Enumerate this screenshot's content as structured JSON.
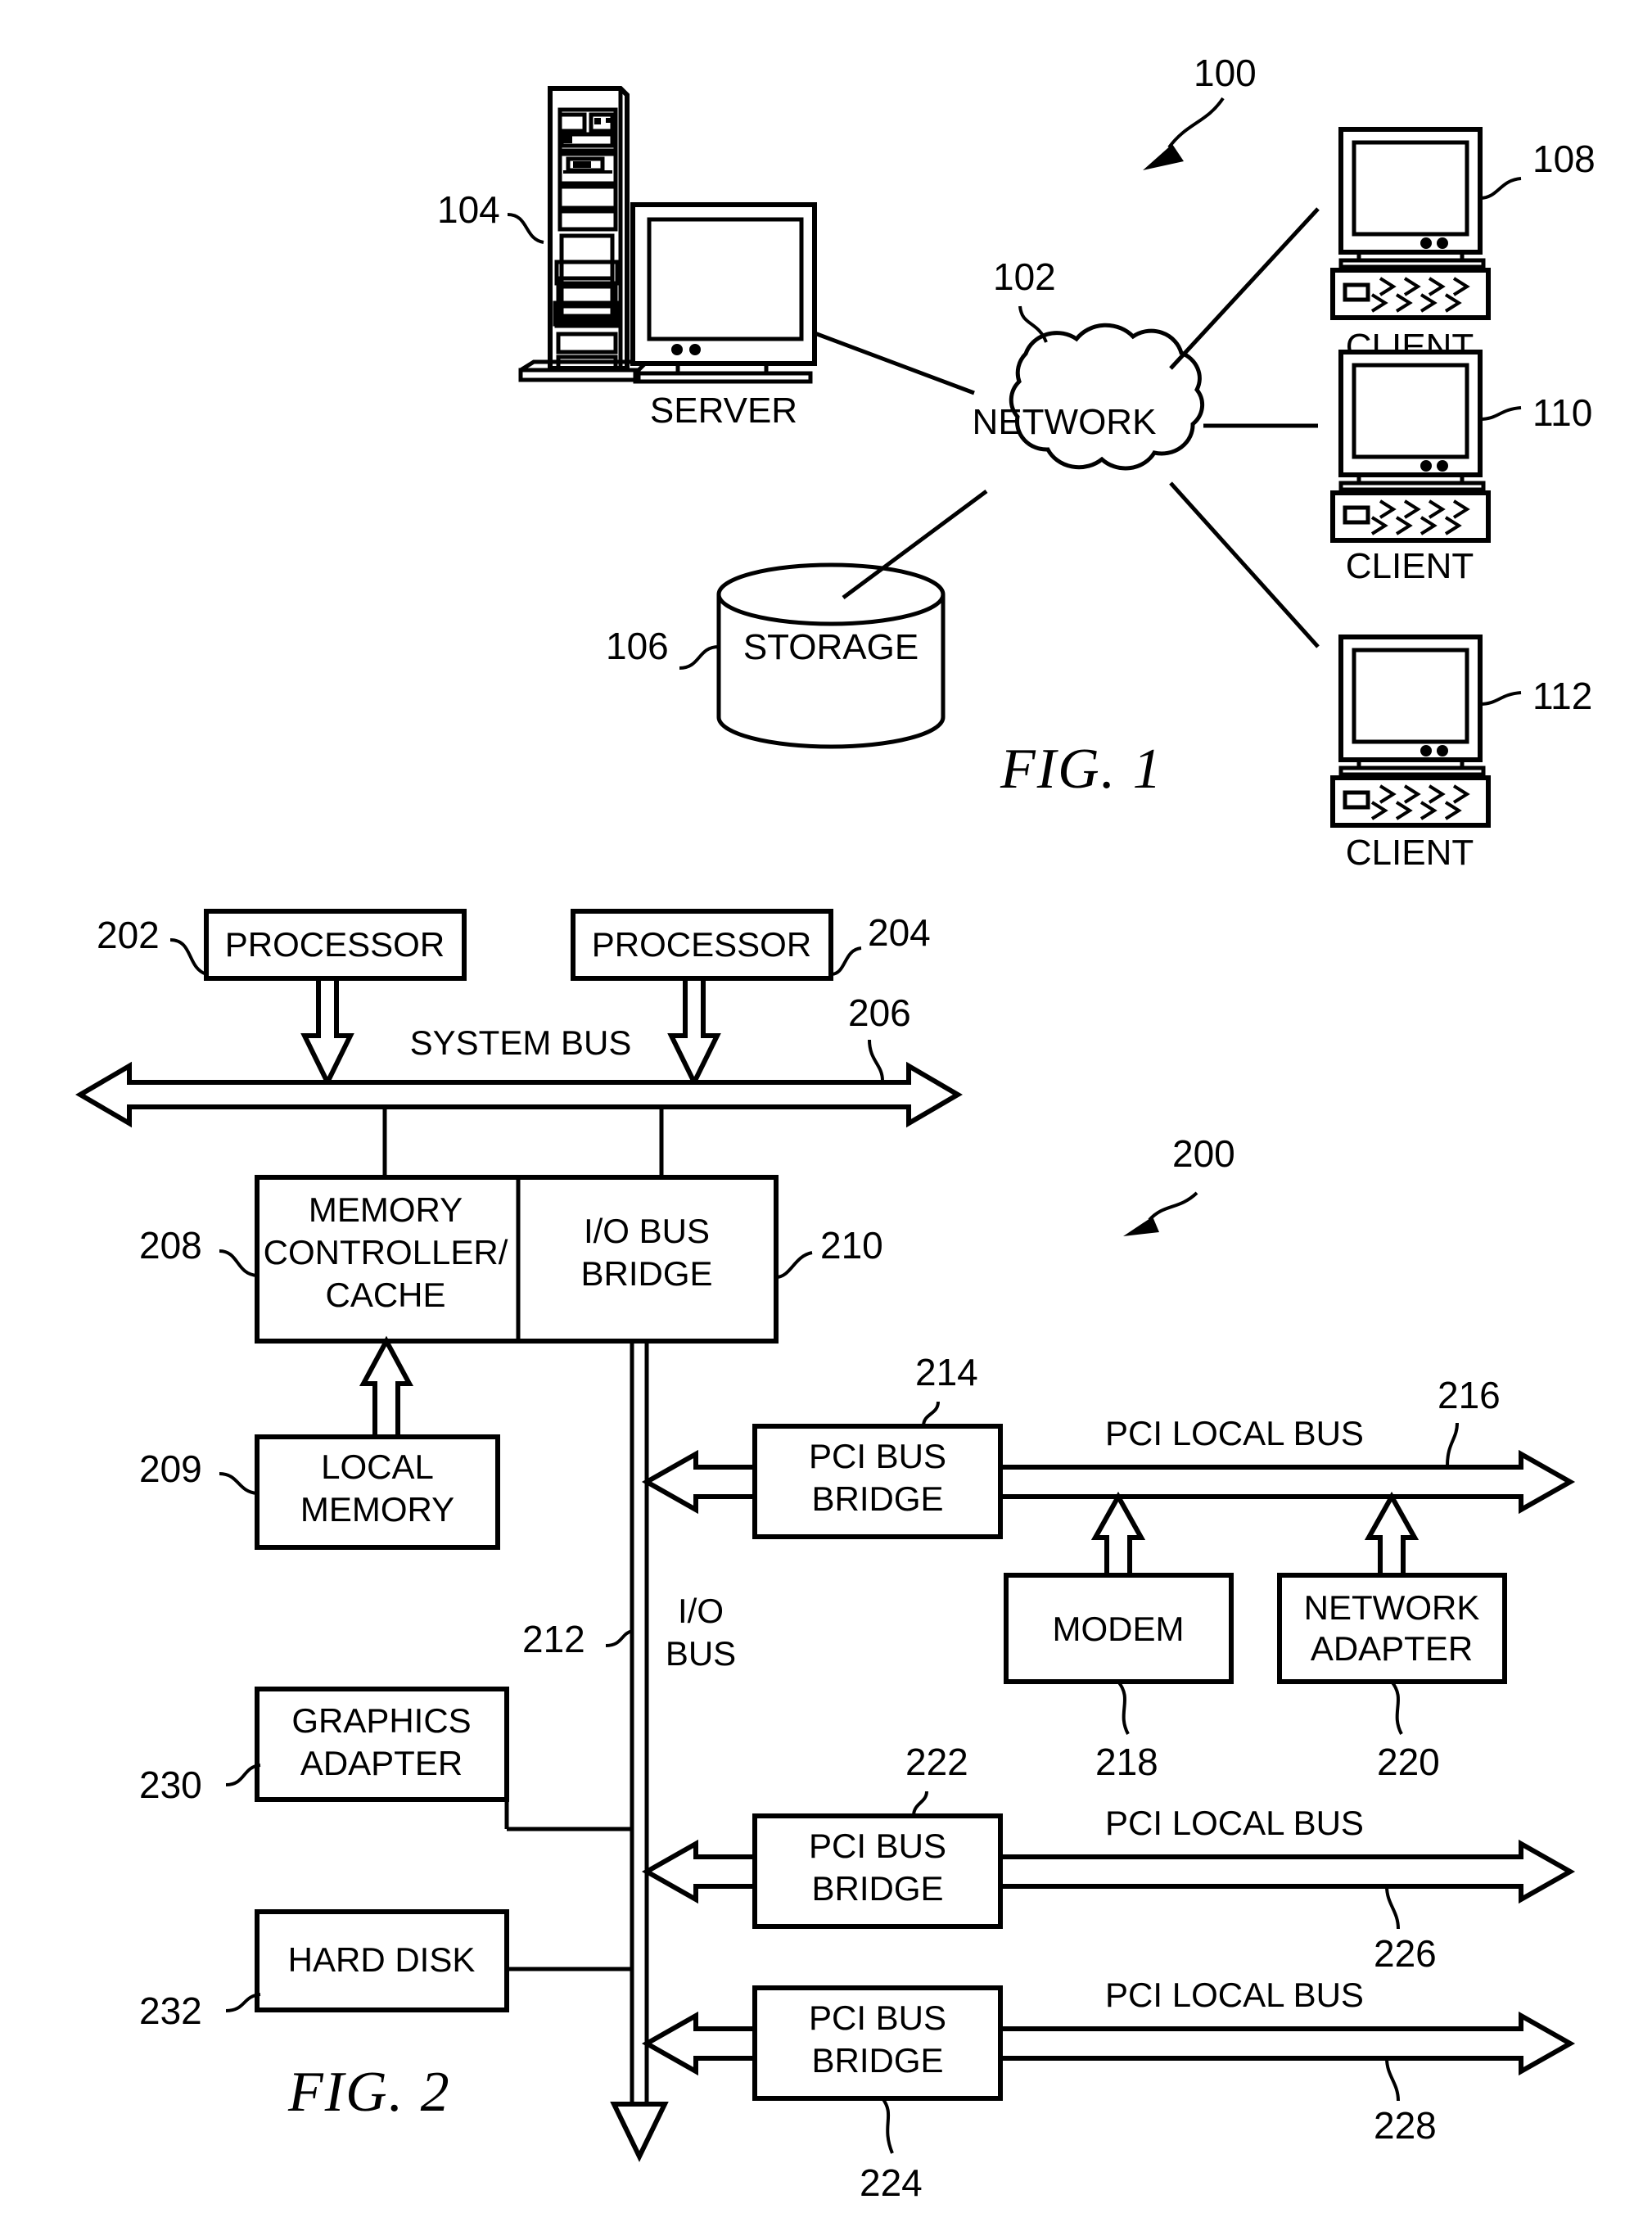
{
  "document": {
    "type": "patent-drawing-sheet",
    "figures": [
      "FIG. 1",
      "FIG. 2"
    ]
  },
  "figure1": {
    "caption": "FIG. 1",
    "system_ref": "100",
    "nodes": {
      "server": {
        "label": "SERVER",
        "ref": "104",
        "icon": "server-tower-and-monitor-icon"
      },
      "network": {
        "label": "NETWORK",
        "ref": "102",
        "icon": "cloud-icon"
      },
      "storage": {
        "label": "STORAGE",
        "ref": "106",
        "icon": "cylinder-database-icon"
      },
      "client1": {
        "label": "CLIENT",
        "ref": "108",
        "icon": "desktop-computer-icon"
      },
      "client2": {
        "label": "CLIENT",
        "ref": "110",
        "icon": "desktop-computer-icon"
      },
      "client3": {
        "label": "CLIENT",
        "ref": "112",
        "icon": "desktop-computer-icon"
      }
    }
  },
  "figure2": {
    "caption": "FIG. 2",
    "system_ref": "200",
    "blocks": {
      "processor1": {
        "label": "PROCESSOR",
        "ref": "202"
      },
      "processor2": {
        "label": "PROCESSOR",
        "ref": "204"
      },
      "memory_controller": {
        "line1": "MEMORY",
        "line2": "CONTROLLER/",
        "line3": "CACHE",
        "ref": "208"
      },
      "io_bus_bridge": {
        "line1": "I/O BUS",
        "line2": "BRIDGE",
        "ref": "210"
      },
      "local_memory": {
        "line1": "LOCAL",
        "line2": "MEMORY",
        "ref": "209"
      },
      "pci_bus_bridge_1": {
        "line1": "PCI BUS",
        "line2": "BRIDGE",
        "ref": "214"
      },
      "pci_bus_bridge_2": {
        "line1": "PCI BUS",
        "line2": "BRIDGE",
        "ref": "222"
      },
      "pci_bus_bridge_3": {
        "line1": "PCI BUS",
        "line2": "BRIDGE",
        "ref": "224"
      },
      "modem": {
        "label": "MODEM",
        "ref": "218"
      },
      "network_adapter": {
        "line1": "NETWORK",
        "line2": "ADAPTER",
        "ref": "220"
      },
      "graphics_adapter": {
        "line1": "GRAPHICS",
        "line2": "ADAPTER",
        "ref": "230"
      },
      "hard_disk": {
        "label": "HARD DISK",
        "ref": "232"
      }
    },
    "buses": {
      "system_bus": {
        "label": "SYSTEM BUS",
        "ref": "206"
      },
      "io_bus": {
        "line1": "I/O",
        "line2": "BUS",
        "ref": "212"
      },
      "pci_local_bus_1": {
        "label": "PCI LOCAL BUS",
        "ref": "216"
      },
      "pci_local_bus_2": {
        "label": "PCI LOCAL BUS",
        "ref": "226"
      },
      "pci_local_bus_3": {
        "label": "PCI LOCAL BUS",
        "ref": "228"
      }
    }
  },
  "colors": {
    "ink": "#000000",
    "paper": "#ffffff"
  }
}
